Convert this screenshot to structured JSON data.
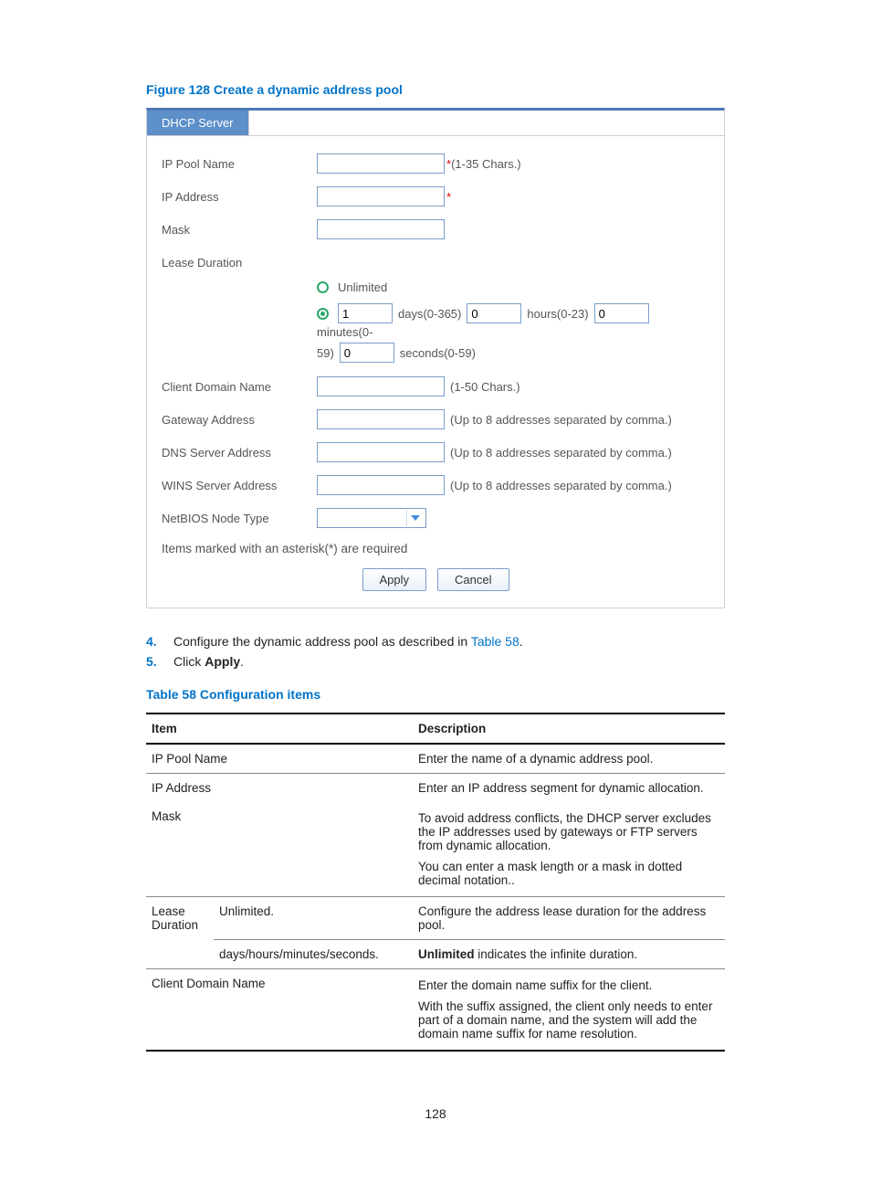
{
  "figure_caption": "Figure 128 Create a dynamic address pool",
  "panel": {
    "tab": "DHCP Server",
    "labels": {
      "ip_pool_name": "IP Pool Name",
      "ip_address": "IP Address",
      "mask": "Mask",
      "lease_duration": "Lease Duration",
      "unlimited": "Unlimited",
      "days_hint": "days(0-365)",
      "hours_hint": "hours(0-23)",
      "minutes_prefix": "minutes(0-",
      "minutes_suffix": "59)",
      "seconds_hint": "seconds(0-59)",
      "client_domain_name": "Client Domain Name",
      "gateway_address": "Gateway Address",
      "dns_server_address": "DNS Server Address",
      "wins_server_address": "WINS Server Address",
      "netbios_node_type": "NetBIOS Node Type"
    },
    "hints": {
      "chars_1_35": " (1-35 Chars.)",
      "chars_1_50": "(1-50 Chars.)",
      "up_to_8": "(Up to 8 addresses separated by comma.)"
    },
    "values": {
      "days": "1",
      "hours": "0",
      "minutes": "0",
      "seconds": "0"
    },
    "required_note": "Items marked with an asterisk(*) are required",
    "buttons": {
      "apply": "Apply",
      "cancel": "Cancel"
    },
    "asterisk": "*"
  },
  "steps": {
    "s4_pre": "Configure the dynamic address pool as described in ",
    "s4_link": "Table 58",
    "s4_post": ".",
    "s5_pre": "Click ",
    "s5_bold": "Apply",
    "s5_post": "."
  },
  "table_caption": "Table 58 Configuration items",
  "table": {
    "head_item": "Item",
    "head_desc": "Description",
    "rows": {
      "ip_pool_name": {
        "item": "IP Pool Name",
        "desc": "Enter the name of a dynamic address pool."
      },
      "ip_address": {
        "item": "IP Address",
        "desc": "Enter an IP address segment for dynamic allocation."
      },
      "mask": {
        "item": "Mask",
        "desc1": "To avoid address conflicts, the DHCP server excludes the IP addresses used by gateways or FTP servers from dynamic allocation.",
        "desc2": "You can enter a mask length or a mask in dotted decimal notation.."
      },
      "lease": {
        "item": "Lease Duration",
        "sub1": "Unlimited.",
        "sub2": "days/hours/minutes/seconds.",
        "desc1": "Configure the address lease duration for the address pool.",
        "desc2_pre": "",
        "desc2_bold": "Unlimited",
        "desc2_post": " indicates the infinite duration."
      },
      "client_domain": {
        "item": "Client Domain Name",
        "desc1": "Enter the domain name suffix for the client.",
        "desc2": "With the suffix assigned, the client only needs to enter part of a domain name, and the system will add the domain name suffix for name resolution."
      }
    }
  },
  "page_number": "128"
}
